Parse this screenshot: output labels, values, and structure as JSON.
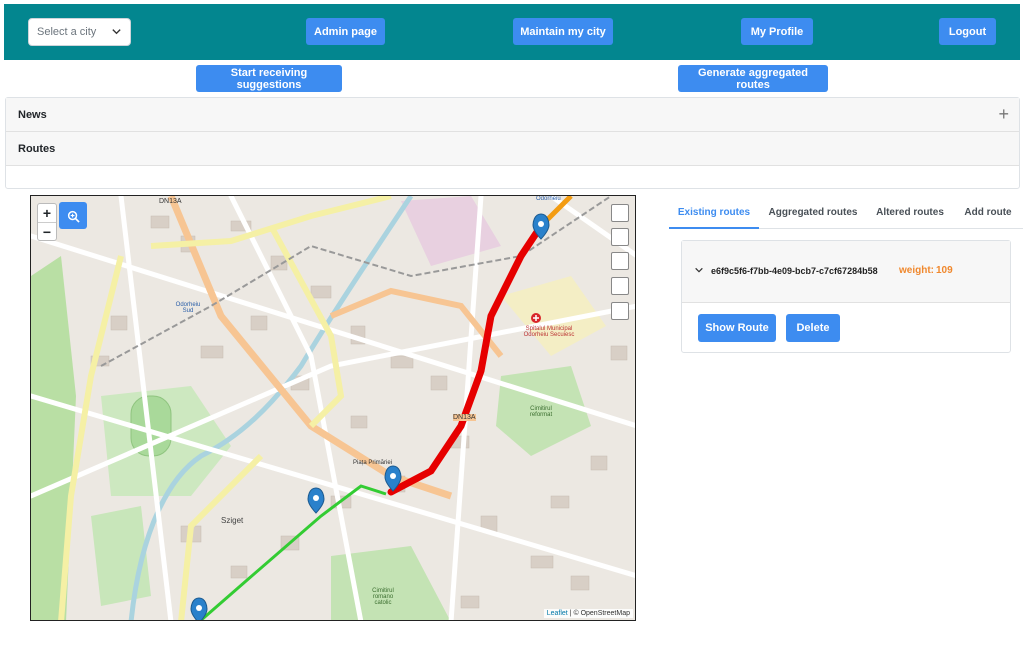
{
  "topbar": {
    "city_select": {
      "placeholder": "Select a city"
    },
    "admin_label": "Admin page",
    "maintain_label": "Maintain my city",
    "profile_label": "My Profile",
    "logout_label": "Logout",
    "bg_color": "#03868f"
  },
  "actions": {
    "start_label": "Start receiving suggestions",
    "generate_label": "Generate aggregated routes"
  },
  "accordion": {
    "news_label": "News",
    "routes_label": "Routes"
  },
  "map": {
    "zoom_in": "+",
    "zoom_out": "−",
    "attribution_leaflet": "Leaflet",
    "attribution_rest": "| © OpenStreetMap",
    "labels": {
      "dn13a": "DN13A",
      "odorheiu_sud": "Odorheiu Sud",
      "odorheiu": "Odorheiu",
      "sziget": "Sziget",
      "spital": "Spitalul Municipal Odorheiu Secuiesc",
      "cimitir_ref": "Cimitirul reformat",
      "cimitir_cat": "Cimitirul romano catolic",
      "piata": "Piața Primăriei"
    }
  },
  "tabs": {
    "existing": "Existing routes",
    "aggregated": "Aggregated routes",
    "altered": "Altered routes",
    "add": "Add route"
  },
  "route": {
    "id": "e6f9c5f6-f7bb-4e09-bcb7-c7cf67284b58",
    "weight_label": "weight:",
    "weight_value": "109",
    "show_label": "Show Route",
    "delete_label": "Delete"
  },
  "colors": {
    "accent": "#3d8cf0",
    "weight": "#f0882d",
    "route_red": "#e60000",
    "route_green": "#33cc33"
  }
}
